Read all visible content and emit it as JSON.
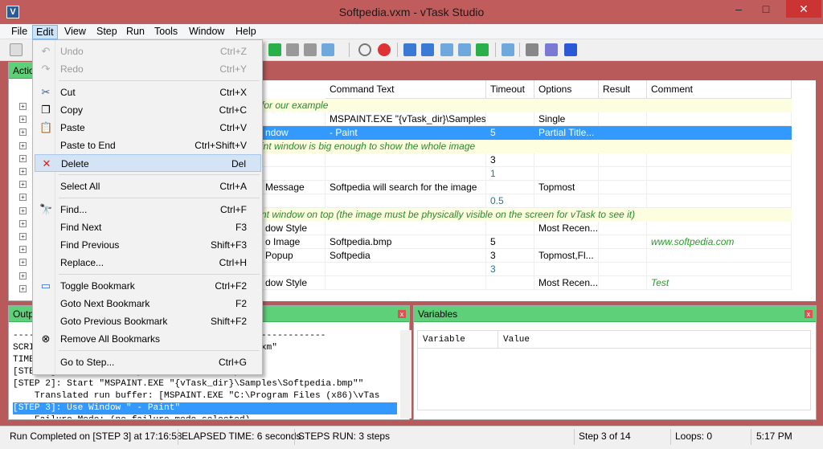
{
  "window": {
    "title": "Softpedia.vxm - vTask Studio",
    "logo": "V",
    "min": "–",
    "max": "□",
    "close": "✕"
  },
  "menu": [
    "File",
    "Edit",
    "View",
    "Step",
    "Run",
    "Tools",
    "Window",
    "Help"
  ],
  "actions_panel": {
    "title": "Actio"
  },
  "grid": {
    "headers": [
      "Command Text",
      "Timeout",
      "Options",
      "Result",
      "Comment"
    ],
    "rows": [
      {
        "type": "comment",
        "text": "for our example"
      },
      {
        "name": "",
        "cmd": "MSPAINT.EXE \"{vTask_dir}\\Samples\\...",
        "timeout": "",
        "options": "Single",
        "comment": ""
      },
      {
        "type": "selected",
        "name": "ndow",
        "cmd": " - Paint",
        "timeout": "5",
        "options": "Partial Title...",
        "comment": ""
      },
      {
        "type": "comment",
        "text": "int window is big enough to show the whole image"
      },
      {
        "name": "",
        "cmd": "",
        "timeout": "3",
        "options": "",
        "comment": ""
      },
      {
        "name": "",
        "cmd": "",
        "timeout": "1",
        "options": "",
        "comment": "",
        "blue": true
      },
      {
        "name": "Message",
        "cmd": "Softpedia will search for the image",
        "timeout": "",
        "options": "Topmost",
        "comment": ""
      },
      {
        "name": "",
        "cmd": "",
        "timeout": "0.5",
        "options": "",
        "comment": "",
        "blue": true
      },
      {
        "type": "comment",
        "text": "nt window on top (the image must be physically visible on the screen for vTask to see it)"
      },
      {
        "name": "dow Style",
        "cmd": "",
        "timeout": "",
        "options": "Most Recen...",
        "comment": ""
      },
      {
        "name": "o Image",
        "cmd": "Softpedia.bmp",
        "timeout": "5",
        "options": "",
        "comment": "www.softpedia.com"
      },
      {
        "name": "Popup",
        "cmd": "Softpedia",
        "timeout": "3",
        "options": "Topmost,Fl...",
        "comment": ""
      },
      {
        "name": "",
        "cmd": "",
        "timeout": "3",
        "options": "",
        "comment": "",
        "blue": true
      },
      {
        "name": "dow Style",
        "cmd": "",
        "timeout": "",
        "options": "Most Recen...",
        "comment": "Test"
      }
    ]
  },
  "output_panel": {
    "title": "Outp",
    "close": "x",
    "lines": [
      "----------------------------------------------------------",
      "SCRIPT: C:\\Users\\Softpedia\\Desktop\\Softpedia.vxm\"",
      "TIME: ...",
      "[STEP 1]: Comment \"Softpedia for our example\"",
      "[STEP 2]: Start \"MSPAINT.EXE \"{vTask_dir}\\Samples\\Softpedia.bmp\"\"",
      "    Translated run buffer: [MSPAINT.EXE \"C:\\Program Files (x86)\\vTas",
      "[STEP 3]: Use Window \" - Paint\"",
      "    Failure Mode: (no failure mode selected)"
    ]
  },
  "variables_panel": {
    "title": "Variables",
    "close": "x",
    "col_variable": "Variable",
    "col_value": "Value"
  },
  "status": {
    "run": "Run Completed on [STEP 3] at 17:16:58",
    "elapsed": "ELAPSED TIME: 6 seconds",
    "steps": "STEPS RUN: 3 steps",
    "step_of": "Step 3 of 14",
    "loops": "Loops: 0",
    "time": "5:17 PM"
  },
  "edit_menu": [
    {
      "label": "Undo",
      "shortcut": "Ctrl+Z",
      "disabled": true,
      "icon": "undo-icon",
      "glyph": "↶"
    },
    {
      "label": "Redo",
      "shortcut": "Ctrl+Y",
      "disabled": true,
      "icon": "redo-icon",
      "glyph": "↷"
    },
    {
      "sep": true
    },
    {
      "label": "Cut",
      "shortcut": "Ctrl+X",
      "icon": "scissors-icon",
      "glyph": "✂"
    },
    {
      "label": "Copy",
      "shortcut": "Ctrl+C",
      "icon": "copy-icon",
      "glyph": "❐"
    },
    {
      "label": "Paste",
      "shortcut": "Ctrl+V",
      "icon": "paste-icon",
      "glyph": "📋"
    },
    {
      "label": "Paste to End",
      "shortcut": "Ctrl+Shift+V",
      "icon": "",
      "glyph": ""
    },
    {
      "label": "Delete",
      "shortcut": "Del",
      "icon": "delete-icon",
      "glyph": "✕",
      "hover": true
    },
    {
      "sep": true
    },
    {
      "label": "Select All",
      "shortcut": "Ctrl+A",
      "icon": "",
      "glyph": ""
    },
    {
      "sep": true
    },
    {
      "label": "Find...",
      "shortcut": "Ctrl+F",
      "icon": "binoculars-icon",
      "glyph": "🔭"
    },
    {
      "label": "Find Next",
      "shortcut": "F3",
      "icon": "",
      "glyph": ""
    },
    {
      "label": "Find Previous",
      "shortcut": "Shift+F3",
      "icon": "",
      "glyph": ""
    },
    {
      "label": "Replace...",
      "shortcut": "Ctrl+H",
      "icon": "",
      "glyph": ""
    },
    {
      "sep": true
    },
    {
      "label": "Toggle Bookmark",
      "shortcut": "Ctrl+F2",
      "icon": "bookmark-icon",
      "glyph": "▭"
    },
    {
      "label": "Goto Next Bookmark",
      "shortcut": "F2",
      "icon": "",
      "glyph": ""
    },
    {
      "label": "Goto Previous Bookmark",
      "shortcut": "Shift+F2",
      "icon": "",
      "glyph": ""
    },
    {
      "label": "Remove All Bookmarks",
      "shortcut": "",
      "icon": "remove-bookmarks-icon",
      "glyph": "⊗"
    },
    {
      "sep": true
    },
    {
      "label": "Go to Step...",
      "shortcut": "Ctrl+G",
      "icon": "",
      "glyph": ""
    }
  ]
}
